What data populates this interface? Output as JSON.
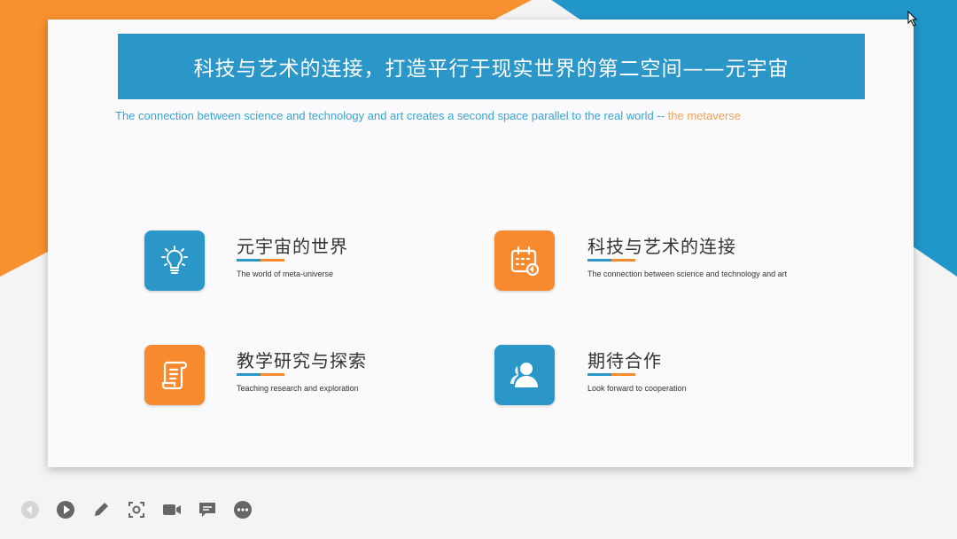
{
  "colors": {
    "blue": "#2b97c9",
    "orange": "#f78a2f"
  },
  "slide": {
    "title": "科技与艺术的连接，打造平行于现实世界的第二空间——元宇宙",
    "subtitle_blue": "The connection between science and technology and art creates a second space parallel to the real world -- ",
    "subtitle_orange": "the metaverse",
    "items": [
      {
        "icon": "lightbulb-icon",
        "color": "blue",
        "title": "元宇宙的世界",
        "desc": "The world of meta-universe"
      },
      {
        "icon": "calendar-icon",
        "color": "orange",
        "title": "科技与艺术的连接",
        "desc": "The connection between science and technology and art"
      },
      {
        "icon": "document-scroll-icon",
        "color": "orange",
        "title": "教学研究与探索",
        "desc": "Teaching research and exploration"
      },
      {
        "icon": "users-icon",
        "color": "blue",
        "title": "期待合作",
        "desc": "Look forward to cooperation"
      }
    ]
  },
  "toolbar": [
    "previous-icon",
    "play-icon",
    "pen-icon",
    "screenshot-icon",
    "camera-icon",
    "comment-icon",
    "more-icon"
  ]
}
